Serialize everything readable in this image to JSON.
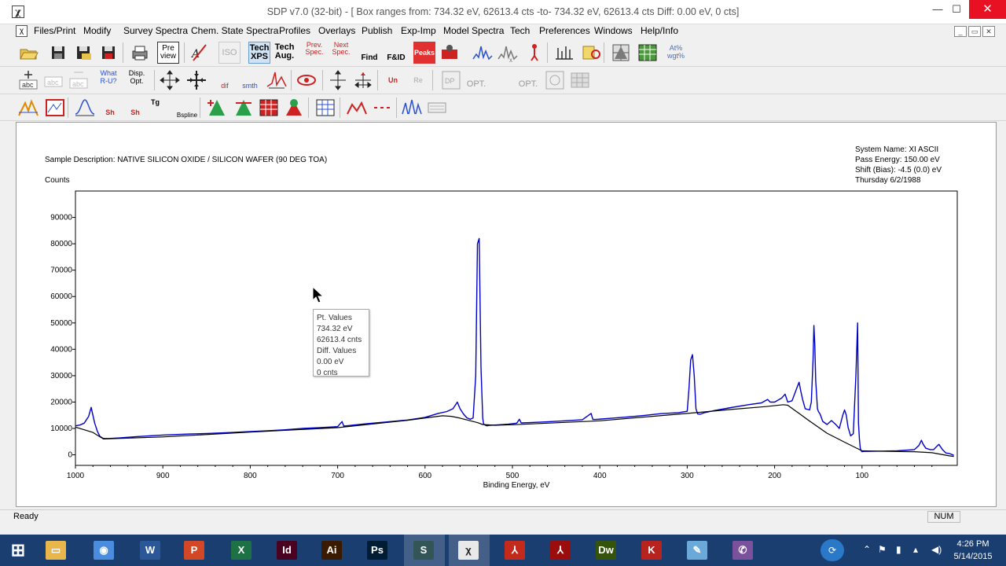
{
  "window": {
    "title": "SDP v7.0 (32-bit) - [ Box ranges from:  734.32 eV, 62613.4 cts  -to-  734.32 eV, 62613.4 cts  Diff: 0.00 eV, 0 cts]",
    "app_icon_glyph": "χ",
    "min_glyph": "—",
    "max_glyph": "☐",
    "close_glyph": "✕"
  },
  "menubar": {
    "items": [
      "Files/Print",
      "Modify",
      "Survey Spectra",
      "Chem. State Spectra",
      "Profiles",
      "Overlays",
      "Publish",
      "Exp-Imp",
      "Model Spectra",
      "Tech",
      "Preferences",
      "Windows",
      "Help/Info"
    ],
    "mdi_min": "_",
    "mdi_restore": "▭",
    "mdi_close": "✕"
  },
  "toolbar": {
    "tech_xps_label": "Tech XPS",
    "tech_aug_label": "Tech Aug.",
    "preview_label": "Pre view",
    "iso_label": "ISO",
    "prev_spec_label": "Prev. Spec.",
    "next_spec_label": "Next Spec.",
    "find_label": "Find",
    "fid_label": "F&ID",
    "peaks_label": "Peaks",
    "atwt_label": "At% wgt%",
    "whatru_label": "What R-U?",
    "dispopt_label": "Disp. Opt.",
    "dif_label": "dif",
    "smth_label": "smth",
    "un_label": "Un",
    "re_label": "Re",
    "opt2d_label": "OPT.",
    "opt3d_label": "OPT.",
    "sh_label": "Sh",
    "tg_label": "Tg",
    "bspline_label": "Bspline"
  },
  "header_info": {
    "sample_description": "Sample Description:  NATIVE SILICON OXIDE / SILICON WAFER (90 DEG TOA)",
    "counts_label": "Counts",
    "system_name": "System Name:  XI ASCII",
    "pass_energy": "Pass Energy: 150.00 eV",
    "shift": "Shift (Bias): -4.5 (0.0) eV",
    "date": "Thursday  6/2/1988"
  },
  "tooltip": {
    "title": "Pt. Values",
    "energy": "734.32 eV",
    "counts": "62613.4 cnts",
    "diff_title": "Diff. Values",
    "diff_energy": "0.00 eV",
    "diff_counts": "0 cnts"
  },
  "chart_data": {
    "type": "line",
    "title": "",
    "xlabel": "Binding Energy, eV",
    "ylabel": "Counts",
    "xlim": [
      1000,
      -9
    ],
    "ylim": [
      -4000,
      100000
    ],
    "x_ticks": [
      1000,
      900,
      800,
      700,
      600,
      500,
      400,
      300,
      200,
      100
    ],
    "y_ticks": [
      0,
      10000,
      20000,
      30000,
      40000,
      50000,
      60000,
      70000,
      80000,
      90000
    ],
    "series": [
      {
        "color": "#0000cc",
        "x": [
          1000,
          995,
          990,
          985,
          982,
          980,
          978,
          975,
          972,
          968,
          962,
          950,
          930,
          900,
          870,
          850,
          820,
          800,
          780,
          760,
          740,
          720,
          700,
          695,
          693,
          690,
          670,
          650,
          620,
          600,
          585,
          575,
          568,
          563,
          560,
          556,
          552,
          548,
          545,
          542,
          540,
          538,
          536,
          534,
          533,
          531,
          529,
          526,
          520,
          505,
          495,
          492,
          490,
          480,
          460,
          440,
          420,
          410,
          408,
          405,
          390,
          370,
          350,
          330,
          310,
          300,
          298,
          296,
          294,
          292,
          290,
          288,
          285,
          280,
          270,
          250,
          230,
          215,
          208,
          205,
          200,
          192,
          188,
          185,
          180,
          175,
          172,
          170,
          168,
          165,
          160,
          158,
          156,
          155,
          154,
          153,
          151,
          150,
          148,
          145,
          140,
          135,
          130,
          126,
          122,
          120,
          118,
          116,
          113,
          110,
          107,
          105,
          104,
          103,
          102,
          101,
          100,
          98,
          95,
          80,
          60,
          40,
          35,
          32,
          30,
          27,
          22,
          18,
          15,
          12,
          8,
          4,
          0,
          -5
        ],
        "y": [
          11000,
          11300,
          12000,
          14500,
          18000,
          15000,
          12000,
          9000,
          7000,
          6200,
          6200,
          6400,
          6900,
          7500,
          7900,
          8100,
          8500,
          8800,
          9100,
          9500,
          10000,
          10300,
          10700,
          12600,
          10900,
          11000,
          11700,
          12300,
          13200,
          14200,
          15700,
          16400,
          17500,
          20000,
          17500,
          15500,
          14000,
          13500,
          14000,
          30000,
          80000,
          82000,
          33000,
          14000,
          11700,
          11200,
          11000,
          11200,
          11300,
          11600,
          12000,
          13500,
          12100,
          12200,
          12500,
          12900,
          13300,
          15700,
          13400,
          13400,
          13800,
          14300,
          14900,
          15600,
          16000,
          16500,
          25000,
          36000,
          38000,
          30000,
          17500,
          15500,
          15400,
          16000,
          16700,
          17900,
          19000,
          19700,
          21000,
          20000,
          20000,
          21500,
          23000,
          20000,
          20500,
          25000,
          27500,
          24000,
          21000,
          17500,
          17000,
          20000,
          36000,
          49000,
          42000,
          28000,
          17500,
          16500,
          15500,
          12700,
          11500,
          13000,
          11500,
          10000,
          15000,
          17000,
          15000,
          10500,
          7200,
          8000,
          30000,
          50000,
          12000,
          6000,
          2500,
          1500,
          1200,
          1300,
          1300,
          1400,
          1500,
          2000,
          3500,
          5500,
          4000,
          2500,
          2000,
          2000,
          3000,
          4000,
          2000,
          700,
          500,
          -200
        ]
      },
      {
        "color": "#000000",
        "x": [
          1000,
          980,
          968,
          900,
          800,
          700,
          620,
          580,
          570,
          560,
          548,
          540,
          534,
          520,
          500,
          400,
          300,
          250,
          210,
          190,
          185,
          180,
          160,
          140,
          120,
          100,
          70,
          40,
          20,
          0,
          -5
        ],
        "y": [
          10500,
          8500,
          6000,
          6800,
          8600,
          10300,
          13100,
          14800,
          14600,
          13900,
          12900,
          12200,
          11500,
          11200,
          11400,
          12900,
          15700,
          17200,
          18300,
          19000,
          18800,
          17600,
          12800,
          8200,
          4800,
          1500,
          1300,
          1200,
          800,
          -400,
          -600
        ]
      }
    ],
    "grid": false,
    "legend": "none"
  },
  "statusbar": {
    "text": "Ready",
    "num": "NUM"
  },
  "taskbar": {
    "apps": [
      {
        "name": "windows-start",
        "label": "⊞",
        "color": "#1b3e70"
      },
      {
        "name": "file-explorer",
        "label": "▭",
        "color": "#e8b64a"
      },
      {
        "name": "chrome",
        "label": "◉",
        "color": "#4a8cde"
      },
      {
        "name": "word",
        "label": "W",
        "color": "#2b5797"
      },
      {
        "name": "powerpoint",
        "label": "P",
        "color": "#d24726"
      },
      {
        "name": "excel",
        "label": "X",
        "color": "#1e7145"
      },
      {
        "name": "indesign",
        "label": "Id",
        "color": "#49021f"
      },
      {
        "name": "illustrator",
        "label": "Ai",
        "color": "#3b1b00"
      },
      {
        "name": "photoshop",
        "label": "Ps",
        "color": "#001d34"
      },
      {
        "name": "sdp-s",
        "label": "S",
        "color": "#355"
      },
      {
        "name": "sdp-chi",
        "label": "χ",
        "color": "#e9e9e9"
      },
      {
        "name": "acrobat",
        "label": "⅄",
        "color": "#c42a1c"
      },
      {
        "name": "acrobat-pro",
        "label": "⅄",
        "color": "#9b0d0d"
      },
      {
        "name": "dreamweaver",
        "label": "Dw",
        "color": "#35530b"
      },
      {
        "name": "kaspersky",
        "label": "K",
        "color": "#b7231f"
      },
      {
        "name": "notes",
        "label": "✎",
        "color": "#6aa9d8"
      },
      {
        "name": "viber",
        "label": "✆",
        "color": "#7b519d"
      }
    ],
    "clock_time": "4:26 PM",
    "clock_date": "5/14/2015"
  }
}
